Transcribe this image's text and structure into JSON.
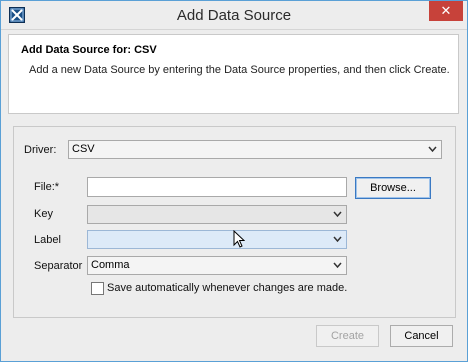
{
  "window": {
    "title": "Add Data Source",
    "close_label": "✕"
  },
  "header": {
    "title": "Add Data Source for: CSV",
    "description": "Add a new Data Source by entering the Data Source properties, and then click Create."
  },
  "form": {
    "driver_label": "Driver:",
    "driver_value": "CSV",
    "file_label": "File:*",
    "file_value": "",
    "browse_label": "Browse...",
    "key_label": "Key",
    "key_value": "",
    "label_label": "Label",
    "label_value": "",
    "separator_label": "Separator",
    "separator_value": "Comma",
    "autosave_label": "Save automatically whenever changes are made.",
    "autosave_checked": false
  },
  "footer": {
    "create_label": "Create",
    "cancel_label": "Cancel"
  },
  "colors": {
    "accent": "#3a79c3",
    "close": "#c7423a",
    "focused_field": "#ddeaf8"
  }
}
